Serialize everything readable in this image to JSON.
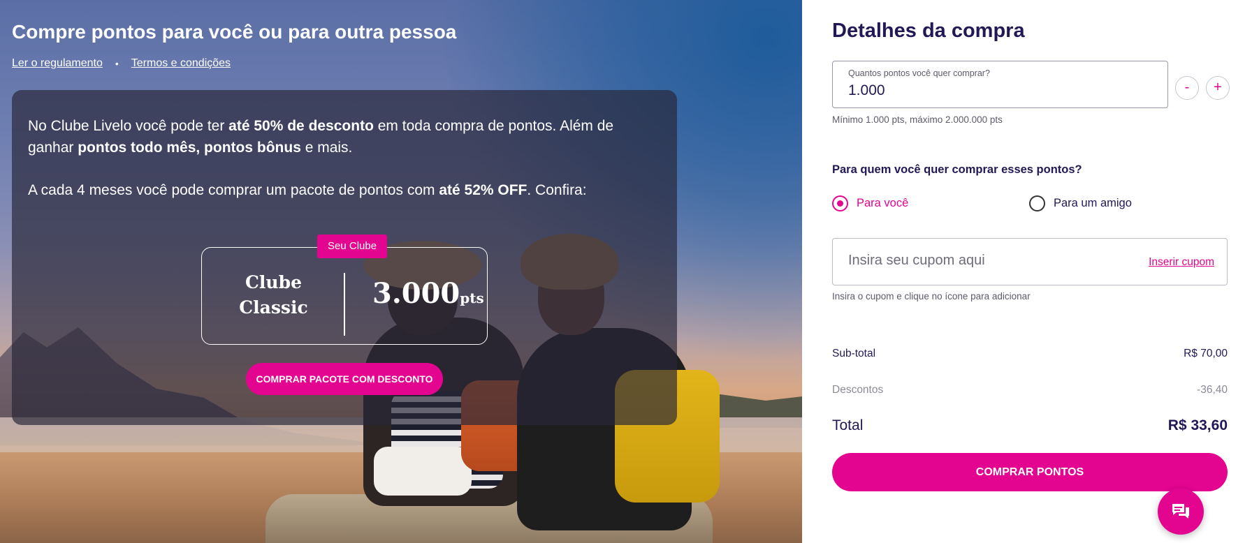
{
  "hero": {
    "title": "Compre pontos para você ou para outra pessoa",
    "links": {
      "regulation": "Ler o regulamento",
      "separator": "•",
      "terms": "Termos e condições"
    },
    "info": {
      "p1_a": "No Clube Livelo você pode ter ",
      "p1_b": "até 50% de desconto",
      "p1_c": " em toda compra de pontos. Além de ganhar ",
      "p1_d": "pontos todo mês, pontos bônus",
      "p1_e": " e mais.",
      "p2_a": "A cada 4 meses você pode comprar um pacote de pontos com ",
      "p2_b": "até 52% OFF",
      "p2_c": ". Confira:"
    },
    "club": {
      "tag": "Seu Clube",
      "name_line1": "Clube",
      "name_line2": "Classic",
      "points": "3.000",
      "points_unit": "pts",
      "button": "COMPRAR PACOTE COM DESCONTO"
    }
  },
  "panel": {
    "title": "Detalhes da compra",
    "quantity": {
      "label": "Quantos pontos você quer comprar?",
      "value": "1.000",
      "minus": "-",
      "plus": "+",
      "hint": "Mínimo 1.000 pts, máximo 2.000.000 pts"
    },
    "recipient": {
      "question": "Para quem você quer comprar esses pontos?",
      "options": [
        {
          "label": "Para você",
          "selected": true
        },
        {
          "label": "Para um amigo",
          "selected": false
        }
      ]
    },
    "coupon": {
      "placeholder": "Insira seu cupom aqui",
      "link": "Inserir cupom",
      "hint": "Insira o cupom e clique no ícone para adicionar"
    },
    "summary": {
      "subtotal_label": "Sub-total",
      "subtotal_value": "R$ 70,00",
      "discount_label": "Descontos",
      "discount_value": "-36,40",
      "total_label": "Total",
      "total_value": "R$ 33,60"
    },
    "buy_button": "COMPRAR PONTOS",
    "chat_icon": "chat-icon"
  },
  "colors": {
    "accent": "#e3058f",
    "navy": "#231856"
  }
}
